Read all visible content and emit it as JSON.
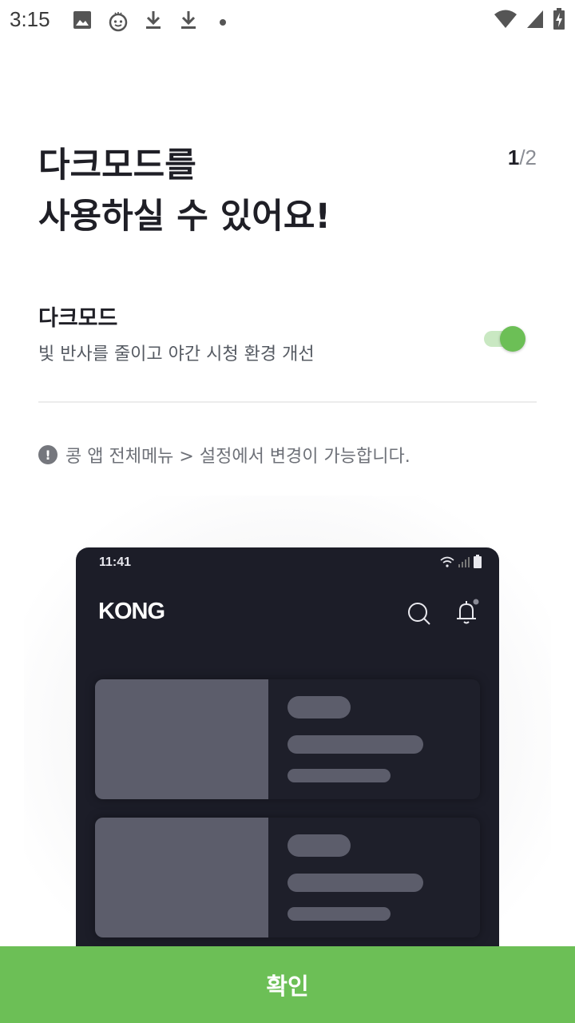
{
  "status_bar": {
    "time": "3:15",
    "left_icons": [
      "image-icon",
      "face-icon",
      "download-icon",
      "download-icon",
      "dot-icon"
    ],
    "right_icons": [
      "wifi-icon",
      "signal-icon",
      "battery-charging-icon"
    ]
  },
  "onboarding": {
    "page_current": "1",
    "page_total": "/2",
    "headline_line1": "다크모드를",
    "headline_line2": "사용하실 수 있어요!",
    "setting_title": "다크모드",
    "setting_desc": "빛 반사를 줄이고 야간 시청 환경 개선",
    "toggle_on": true,
    "notice_icon": "!",
    "notice": "콩 앱 전체메뉴 > 설정에서 변경이 가능합니다."
  },
  "preview": {
    "time": "11:41",
    "logo": "KONG",
    "icons": [
      "search-icon",
      "bell-icon"
    ]
  },
  "colors": {
    "accent": "#6cbf56",
    "dark_bg": "#1c1d28",
    "placeholder": "#5c5d6b"
  },
  "confirm_label": "확인"
}
